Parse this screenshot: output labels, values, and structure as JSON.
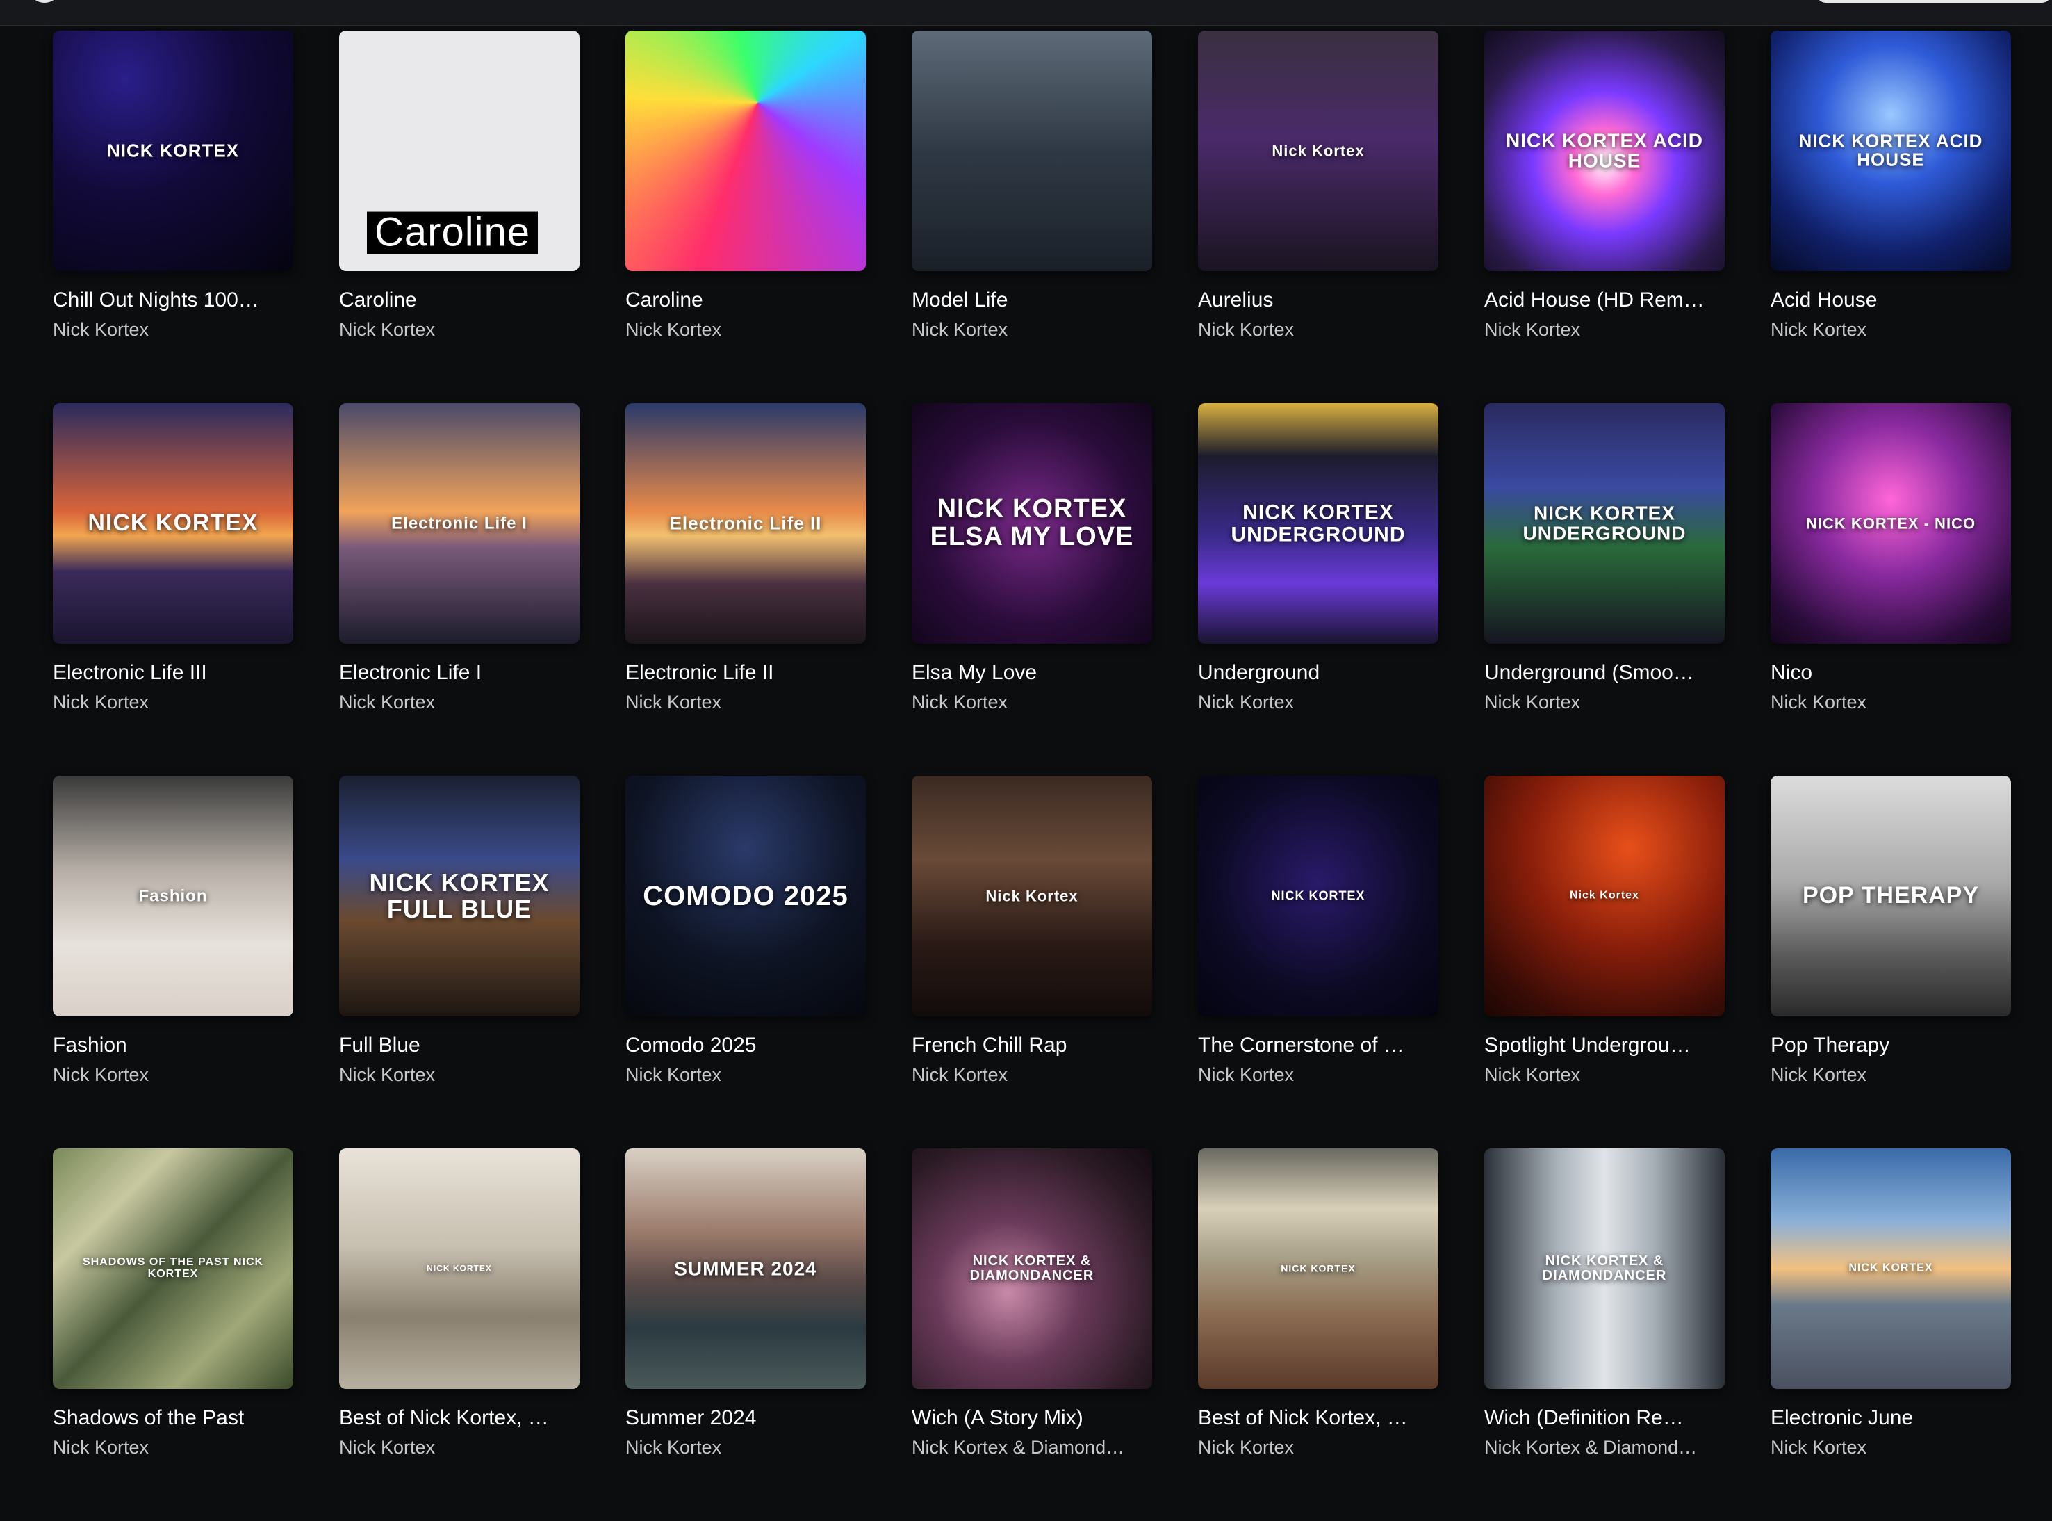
{
  "albums": [
    {
      "title": "Chill Out Nights 100…",
      "artist": "Nick Kortex",
      "cover_text": "NICK KORTEX"
    },
    {
      "title": "Caroline",
      "artist": "Nick Kortex",
      "cover_text": "Caroline"
    },
    {
      "title": "Caroline",
      "artist": "Nick Kortex",
      "cover_text": ""
    },
    {
      "title": "Model Life",
      "artist": "Nick Kortex",
      "cover_text": ""
    },
    {
      "title": "Aurelius",
      "artist": "Nick Kortex",
      "cover_text": "Nick Kortex"
    },
    {
      "title": "Acid House (HD Rem…",
      "artist": "Nick Kortex",
      "cover_text": "NICK KORTEX ACID HOUSE"
    },
    {
      "title": "Acid House",
      "artist": "Nick Kortex",
      "cover_text": "NICK KORTEX ACID HOUSE"
    },
    {
      "title": "Electronic Life III",
      "artist": "Nick Kortex",
      "cover_text": "NICK KORTEX"
    },
    {
      "title": "Electronic Life I",
      "artist": "Nick Kortex",
      "cover_text": "Electronic Life I"
    },
    {
      "title": "Electronic Life II",
      "artist": "Nick Kortex",
      "cover_text": "Electronic Life II"
    },
    {
      "title": "Elsa My Love",
      "artist": "Nick Kortex",
      "cover_text": "NICK KORTEX ELSA MY LOVE"
    },
    {
      "title": "Underground",
      "artist": "Nick Kortex",
      "cover_text": "NICK KORTEX UNDERGROUND"
    },
    {
      "title": "Underground (Smoo…",
      "artist": "Nick Kortex",
      "cover_text": "NICK KORTEX UNDERGROUND"
    },
    {
      "title": "Nico",
      "artist": "Nick Kortex",
      "cover_text": "NICK KORTEX - NICO"
    },
    {
      "title": "Fashion",
      "artist": "Nick Kortex",
      "cover_text": "Fashion"
    },
    {
      "title": "Full Blue",
      "artist": "Nick Kortex",
      "cover_text": "NICK KORTEX FULL BLUE"
    },
    {
      "title": "Comodo 2025",
      "artist": "Nick Kortex",
      "cover_text": "COMODO 2025"
    },
    {
      "title": "French Chill Rap",
      "artist": "Nick Kortex",
      "cover_text": "Nick Kortex"
    },
    {
      "title": "The Cornerstone of …",
      "artist": "Nick Kortex",
      "cover_text": "NICK KORTEX"
    },
    {
      "title": "Spotlight Undergrou…",
      "artist": "Nick Kortex",
      "cover_text": "Nick Kortex"
    },
    {
      "title": "Pop Therapy",
      "artist": "Nick Kortex",
      "cover_text": "POP THERAPY"
    },
    {
      "title": "Shadows of the Past",
      "artist": "Nick Kortex",
      "cover_text": "SHADOWS OF THE PAST NICK KORTEX"
    },
    {
      "title": "Best of Nick Kortex, …",
      "artist": "Nick Kortex",
      "cover_text": "NICK KORTEX"
    },
    {
      "title": "Summer 2024",
      "artist": "Nick Kortex",
      "cover_text": "SUMMER 2024"
    },
    {
      "title": "Wich (A Story Mix)",
      "artist": "Nick Kortex & Diamond…",
      "cover_text": "NICK KORTEX & DIAMONDANCER"
    },
    {
      "title": "Best of Nick Kortex, …",
      "artist": "Nick Kortex",
      "cover_text": "NICK KORTEX"
    },
    {
      "title": "Wich (Definition Re…",
      "artist": "Nick Kortex & Diamond…",
      "cover_text": "NICK KORTEX & DIAMONDANCER"
    },
    {
      "title": "Electronic June",
      "artist": "Nick Kortex",
      "cover_text": "NICK KORTEX"
    }
  ]
}
